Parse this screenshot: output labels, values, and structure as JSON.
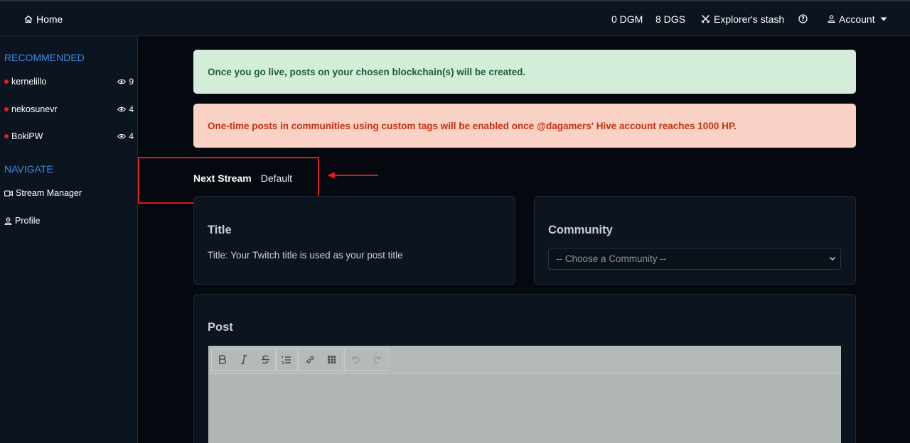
{
  "topnav": {
    "home_label": "Home",
    "dgm_balance": "0 DGM",
    "dgs_balance": "8 DGS",
    "stash_label": "Explorer's stash",
    "account_label": "Account"
  },
  "sidebar": {
    "recommended_heading": "RECOMMENDED",
    "channels": [
      {
        "name": "kernelillo",
        "viewers": "9"
      },
      {
        "name": "nekosunevr",
        "viewers": "4"
      },
      {
        "name": "BokiPW",
        "viewers": "4"
      }
    ],
    "navigate_heading": "NAVIGATE",
    "nav_items": [
      {
        "label": "Stream Manager"
      },
      {
        "label": "Profile"
      }
    ]
  },
  "alerts": {
    "success": "Once you go live, posts on your chosen blockchain(s) will be created.",
    "danger": "One-time posts in communities using custom tags will be enabled once @dagamers' Hive account reaches 1000 HP."
  },
  "next_stream": {
    "label": "Next Stream",
    "value": "Default"
  },
  "title_card": {
    "heading": "Title",
    "text": "Title: Your Twitch title is used as your post title"
  },
  "community_card": {
    "heading": "Community",
    "selected": "-- Choose a Community --"
  },
  "post_card": {
    "heading": "Post"
  },
  "colors": {
    "accent": "#3d8be8",
    "live": "#e0221a",
    "annotation": "#d81e1e",
    "success_bg": "#d4eddb",
    "danger_bg": "#fad2c5"
  },
  "icons": {
    "home": "home-icon",
    "stash": "crossed-swords-icon",
    "help": "question-circle-icon",
    "account": "person-icon",
    "viewers": "eye-icon",
    "stream_manager": "video-camera-icon",
    "profile": "person-icon"
  }
}
